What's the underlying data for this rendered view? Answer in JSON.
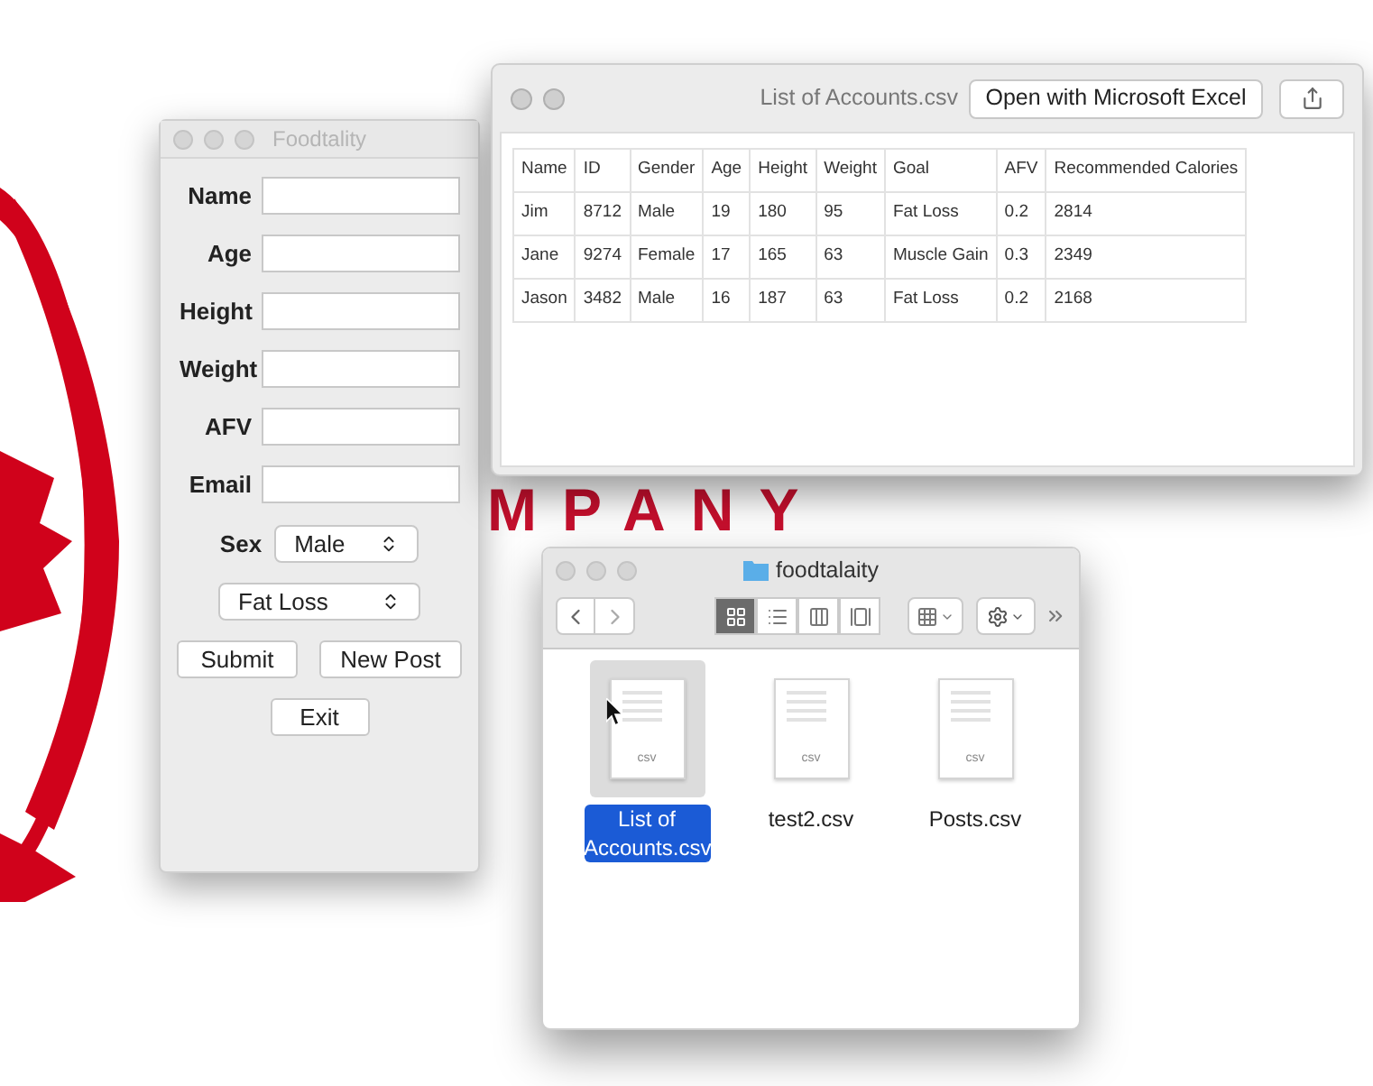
{
  "wallpaper": {
    "text": "MPANY"
  },
  "form_window": {
    "title": "Foodtality",
    "fields": [
      {
        "label": "Name"
      },
      {
        "label": "Age"
      },
      {
        "label": "Height"
      },
      {
        "label": "Weight"
      },
      {
        "label": "AFV"
      },
      {
        "label": "Email"
      }
    ],
    "sex": {
      "label": "Sex",
      "value": "Male"
    },
    "goal": {
      "value": "Fat Loss"
    },
    "buttons": [
      "Submit",
      "New Post",
      "Exit"
    ]
  },
  "preview_window": {
    "title": "List of Accounts.csv",
    "open_button": "Open with Microsoft Excel",
    "table": {
      "columns": [
        "Name",
        "ID",
        "Gender",
        "Age",
        "Height",
        "Weight",
        "Goal",
        "AFV",
        "Recommended Calories"
      ],
      "rows": [
        [
          "Jim",
          "8712",
          "Male",
          "19",
          "180",
          "95",
          "Fat Loss",
          "0.2",
          "2814"
        ],
        [
          "Jane",
          "9274",
          "Female",
          "17",
          "165",
          "63",
          "Muscle Gain",
          "0.3",
          "2349"
        ],
        [
          "Jason",
          "3482",
          "Male",
          "16",
          "187",
          "63",
          "Fat Loss",
          "0.2",
          "2168"
        ]
      ]
    }
  },
  "finder_window": {
    "title": "foodtalaity",
    "view_modes": [
      {
        "kind": "icons",
        "selected": true
      },
      {
        "kind": "list",
        "selected": false
      },
      {
        "kind": "columns",
        "selected": false
      },
      {
        "kind": "gallery",
        "selected": false
      }
    ],
    "files": [
      {
        "name": "List of Accounts.csv",
        "type_label": "csv",
        "selected": true
      },
      {
        "name": "test2.csv",
        "type_label": "csv",
        "selected": false
      },
      {
        "name": "Posts.csv",
        "type_label": "csv",
        "selected": false
      }
    ]
  }
}
